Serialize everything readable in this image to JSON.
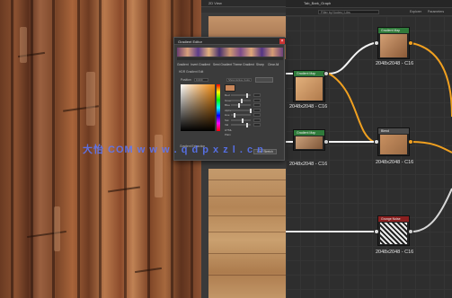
{
  "viewport_2d": {
    "title": "2D View"
  },
  "graph": {
    "title": "Tab_Bark_Graph",
    "search_placeholder": "Filter by Nodes | Libs",
    "tabs": [
      "Explorer",
      "Parameters"
    ]
  },
  "nodes": [
    {
      "name": "Gradient Map",
      "resolution": "2048x2048 - C16",
      "head_color": "#2f7a3a"
    },
    {
      "name": "Gradient Map",
      "resolution": "2048x2048 - C16",
      "head_color": "#2f7a3a"
    },
    {
      "name": "Gradient Map",
      "resolution": "2048x2048 - C16",
      "head_color": "#2f7a3a"
    },
    {
      "name": "Blend",
      "resolution": "2048x2048 - C16",
      "head_color": "#4a4a4a"
    },
    {
      "name": "Grunge Noise",
      "resolution": "2048x2048 - C16",
      "head_color": "#8a1f1f"
    }
  ],
  "color_picker": {
    "title": "Gradient Editor",
    "tabs": [
      "Gradient",
      "Invert Gradient",
      "Semi Gradient",
      "Theme Gradient",
      "Sharp",
      "Clear All"
    ],
    "subtab": "HDR Gradient Edit",
    "position_label": "Position",
    "position_value": "0.000",
    "mode_value": "Show Active Color",
    "channels": [
      "Red",
      "Green",
      "Blue",
      "Alpha",
      "Hue",
      "Sat",
      "Val",
      "HTML",
      "Plain"
    ],
    "bottom_label": "Gradient Extraction",
    "ok_label": "Go / Stretch",
    "swatch_color": "#c8865a",
    "slider_levels": [
      0.78,
      0.52,
      0.35,
      1.0,
      0.08,
      0.55,
      0.78
    ]
  },
  "watermark": "大怡 COM  w w w . q d p x z l . c n"
}
